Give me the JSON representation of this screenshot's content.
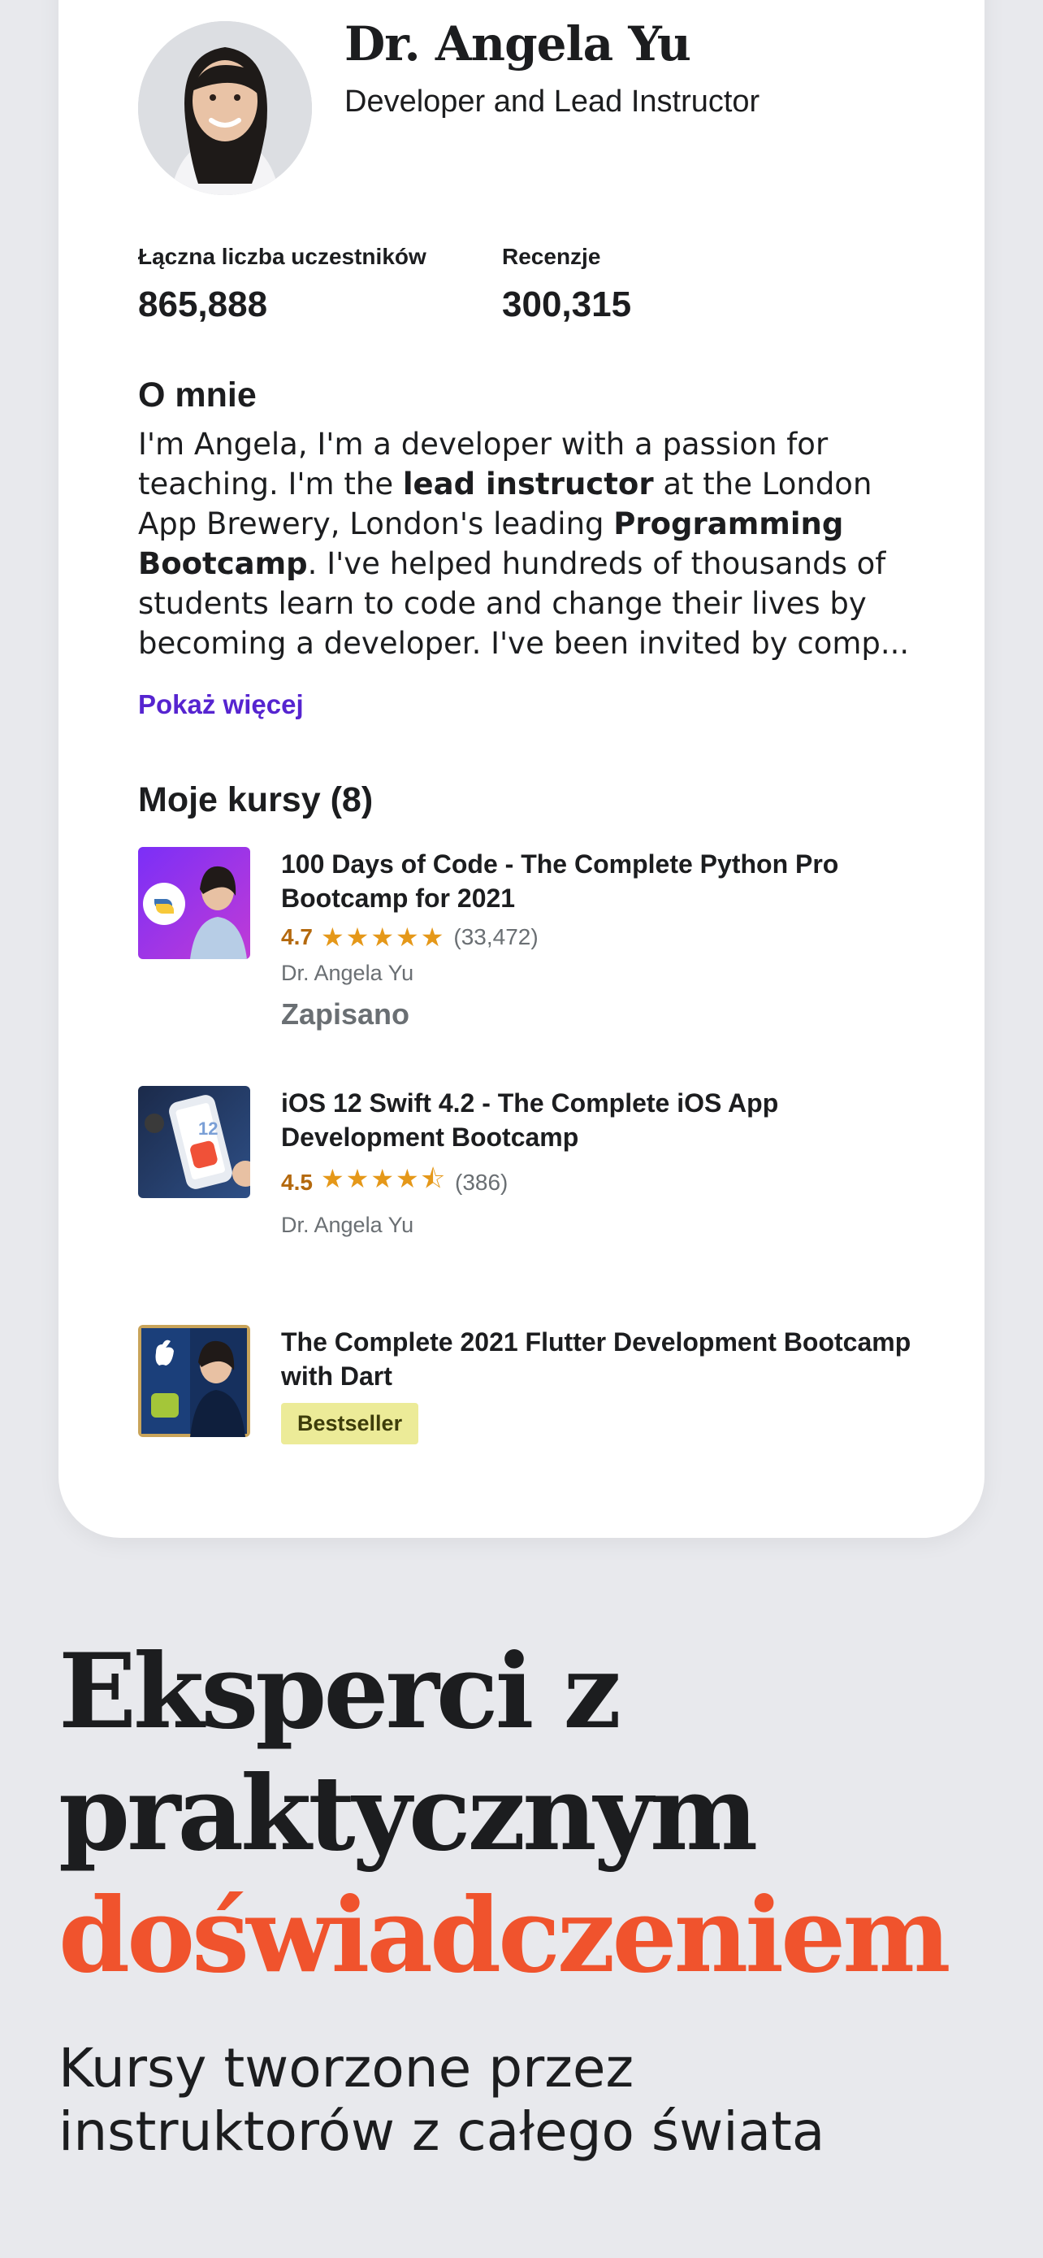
{
  "instructor": {
    "name": "Dr. Angela Yu",
    "headline": "Developer and Lead Instructor",
    "stats": [
      {
        "label": "Łączna liczba uczestników",
        "value": "865,888"
      },
      {
        "label": "Recenzje",
        "value": "300,315"
      }
    ],
    "about_title": "O mnie",
    "about_parts": [
      "I'm Angela, I'm a developer with a passion for teaching. I'm the ",
      "lead instructor",
      " at the London App Brewery, London's leading ",
      "Programming Bootcamp",
      ". I've helped hundreds of thousands of students learn to code and change their lives by becoming a developer. I've been invited by comp..."
    ],
    "show_more": "Pokaż więcej"
  },
  "courses": {
    "title": "Moje kursy (8)",
    "items": [
      {
        "title": "100 Days of Code - The Complete Python Pro Bootcamp for 2021",
        "rating": "4.7",
        "stars": "★★★★★",
        "rating_value": 4.7,
        "reviews": "(33,472)",
        "author": "Dr. Angela Yu",
        "status": "Zapisano"
      },
      {
        "title": "iOS 12 Swift 4.2 - The Complete iOS App Development Bootcamp",
        "rating": "4.5",
        "stars": "★★★★⯪",
        "rating_value": 4.5,
        "reviews": "(386)",
        "author": "Dr. Angela Yu"
      },
      {
        "title": "The Complete 2021 Flutter Development Bootcamp with Dart",
        "badge": "Bestseller"
      }
    ]
  },
  "promo": {
    "line1": "Eksperci z",
    "line2": "praktycznym",
    "line3": "doświadczeniem",
    "subtitle": "Kursy tworzone przez instruktorów z całego świata"
  },
  "colors": {
    "accent_purple": "#5624d0",
    "accent_orange": "#f0532d",
    "rating": "#b4690e",
    "badge_bg": "#eceb98",
    "background": "#e8e9ed"
  },
  "icons": [
    "instructor-avatar",
    "star-icon",
    "python-course-thumbnail",
    "ios-course-thumbnail",
    "flutter-course-thumbnail"
  ]
}
